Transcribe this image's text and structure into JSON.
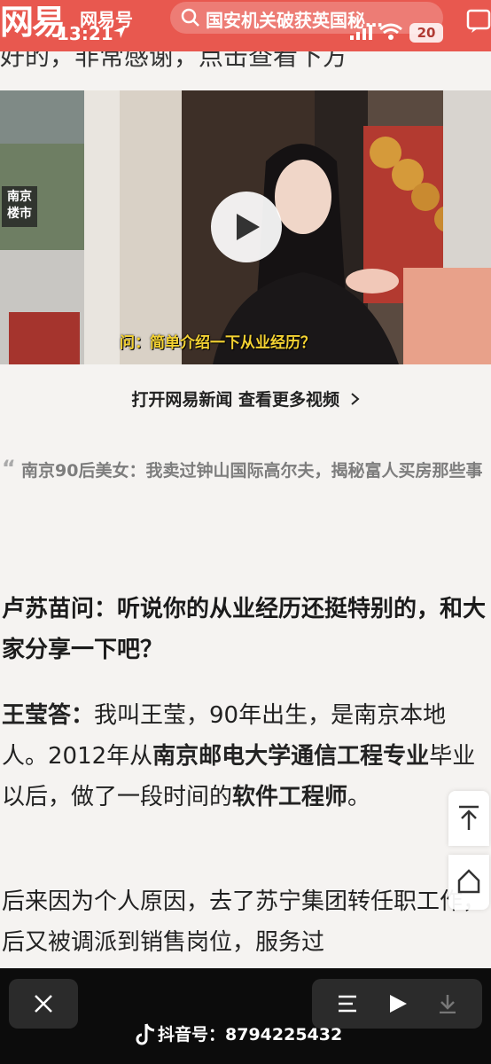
{
  "header": {
    "brand": "网易",
    "channel": "网易号",
    "time": "13:21",
    "search_text": "国安机关破获英国秘…",
    "battery": "20"
  },
  "video": {
    "badge_line1": "南京",
    "badge_line2": "楼市",
    "subtitle": "问：简单介绍一下从业经历？"
  },
  "open_app": "打开网易新闻 查看更多视频",
  "quote": "南京90后美女：我卖过钟山国际高尔夫，揭秘富人买房那些事",
  "question": "卢苏苗问：听说你的从业经历还挺特别的，和大家分享一下吧？",
  "answer": {
    "speaker": "王莹答：",
    "t1": "我叫王莹，90年出生，是南京本地人。2012年从",
    "b1": "南京邮电大学通信工程专业",
    "t2": "毕业以后，做了一段时间的",
    "b2": "软件工程师",
    "t3": "。"
  },
  "paragraph3": "后来因为个人原因，去了苏宁集团转任职工作，后又被调派到销售岗位，服务过",
  "bottom_bar": {
    "watermark": "抖音号：8794225432"
  },
  "icons": [
    "search-icon",
    "signal-icon",
    "wifi-icon",
    "message-icon",
    "play-icon",
    "chevron-right-icon",
    "back-to-top-icon",
    "home-icon",
    "close-icon",
    "list-icon",
    "play-icon",
    "download-icon",
    "tiktok-icon"
  ],
  "colors": {
    "header_red": "#e8584f",
    "subtitle_yellow": "#f4d232",
    "bar_bg": "#0c0c0c"
  }
}
